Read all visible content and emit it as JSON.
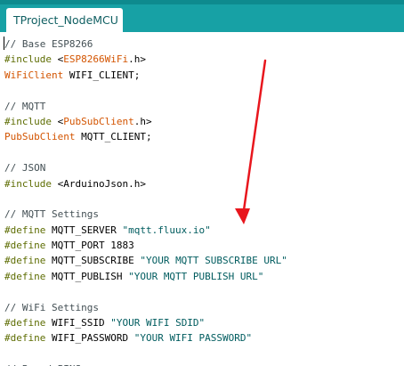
{
  "window": {
    "tab_label": "TProject_NodeMCU"
  },
  "colors": {
    "tabbar": "#17a1a5",
    "comment": "#434f54",
    "directive": "#5e6d03",
    "library": "#d35400",
    "string": "#005c5f",
    "arrow": "#e8161d"
  },
  "code": {
    "lines": [
      [
        {
          "t": "comment",
          "s": "// Base ESP8266"
        }
      ],
      [
        {
          "t": "directive",
          "s": "#include"
        },
        {
          "t": "plain",
          "s": " <"
        },
        {
          "t": "lib",
          "s": "ESP8266WiFi"
        },
        {
          "t": "plain",
          "s": ".h>"
        }
      ],
      [
        {
          "t": "type",
          "s": "WiFiClient"
        },
        {
          "t": "plain",
          "s": " WIFI_CLIENT;"
        }
      ],
      [
        {
          "t": "plain",
          "s": ""
        }
      ],
      [
        {
          "t": "comment",
          "s": "// MQTT"
        }
      ],
      [
        {
          "t": "directive",
          "s": "#include"
        },
        {
          "t": "plain",
          "s": " <"
        },
        {
          "t": "lib",
          "s": "PubSubClient"
        },
        {
          "t": "plain",
          "s": ".h>"
        }
      ],
      [
        {
          "t": "type",
          "s": "PubSubClient"
        },
        {
          "t": "plain",
          "s": " MQTT_CLIENT;"
        }
      ],
      [
        {
          "t": "plain",
          "s": ""
        }
      ],
      [
        {
          "t": "comment",
          "s": "// JSON"
        }
      ],
      [
        {
          "t": "directive",
          "s": "#include"
        },
        {
          "t": "plain",
          "s": " <ArduinoJson.h>"
        }
      ],
      [
        {
          "t": "plain",
          "s": ""
        }
      ],
      [
        {
          "t": "comment",
          "s": "// MQTT Settings"
        }
      ],
      [
        {
          "t": "directive",
          "s": "#define"
        },
        {
          "t": "plain",
          "s": " MQTT_SERVER "
        },
        {
          "t": "string",
          "s": "\"mqtt.fluux.io\""
        }
      ],
      [
        {
          "t": "directive",
          "s": "#define"
        },
        {
          "t": "plain",
          "s": " MQTT_PORT 1883"
        }
      ],
      [
        {
          "t": "directive",
          "s": "#define"
        },
        {
          "t": "plain",
          "s": " MQTT_SUBSCRIBE "
        },
        {
          "t": "string",
          "s": "\"YOUR MQTT SUBSCRIBE URL\""
        }
      ],
      [
        {
          "t": "directive",
          "s": "#define"
        },
        {
          "t": "plain",
          "s": " MQTT_PUBLISH "
        },
        {
          "t": "string",
          "s": "\"YOUR MQTT PUBLISH URL\""
        }
      ],
      [
        {
          "t": "plain",
          "s": ""
        }
      ],
      [
        {
          "t": "comment",
          "s": "// WiFi Settings"
        }
      ],
      [
        {
          "t": "directive",
          "s": "#define"
        },
        {
          "t": "plain",
          "s": " WIFI_SSID "
        },
        {
          "t": "string",
          "s": "\"YOUR WIFI SDID\""
        }
      ],
      [
        {
          "t": "directive",
          "s": "#define"
        },
        {
          "t": "plain",
          "s": " WIFI_PASSWORD "
        },
        {
          "t": "string",
          "s": "\"YOUR WIFI PASSWORD\""
        }
      ],
      [
        {
          "t": "plain",
          "s": ""
        }
      ],
      [
        {
          "t": "comment",
          "s": "// Board PINS"
        }
      ]
    ]
  }
}
